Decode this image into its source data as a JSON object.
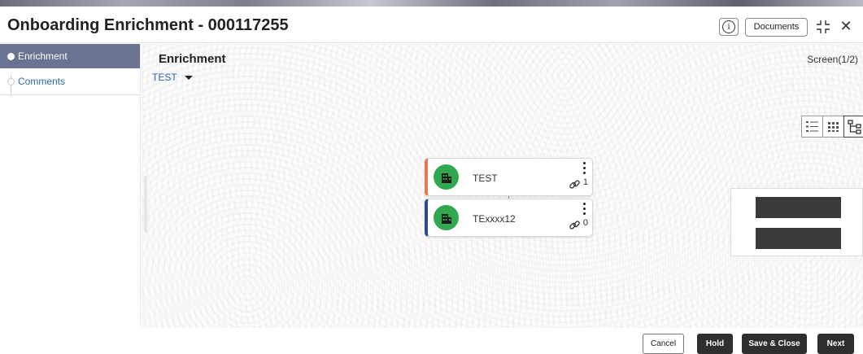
{
  "window": {
    "title": "Onboarding Enrichment - 000117255",
    "info_label": "i",
    "documents_label": "Documents",
    "close_label": "✕"
  },
  "sidebar": {
    "items": [
      {
        "label": "Enrichment",
        "active": true
      },
      {
        "label": "Comments",
        "active": false
      }
    ]
  },
  "main": {
    "section_title": "Enrichment",
    "screen_indicator": "Screen(1/2)",
    "entity_select": "TEST",
    "view_modes": [
      "list-view-icon",
      "grid-view-icon",
      "tree-view-icon"
    ],
    "selected_view": "tree-view-icon",
    "nodes": [
      {
        "name": "TEST",
        "link_count": "1",
        "accent": "#e37a54"
      },
      {
        "name": "TExxxx12",
        "link_count": "0",
        "accent": "#2c4b8a"
      }
    ]
  },
  "footer": {
    "cancel_label": "Cancel",
    "hold_label": "Hold",
    "save_close_label": "Save & Close",
    "next_label": "Next"
  },
  "colors": {
    "sidebar_active": "#6a7391",
    "link_blue": "#2b6aa5",
    "avatar_green": "#2fa84f",
    "button_dark": "#2f2f2f"
  }
}
